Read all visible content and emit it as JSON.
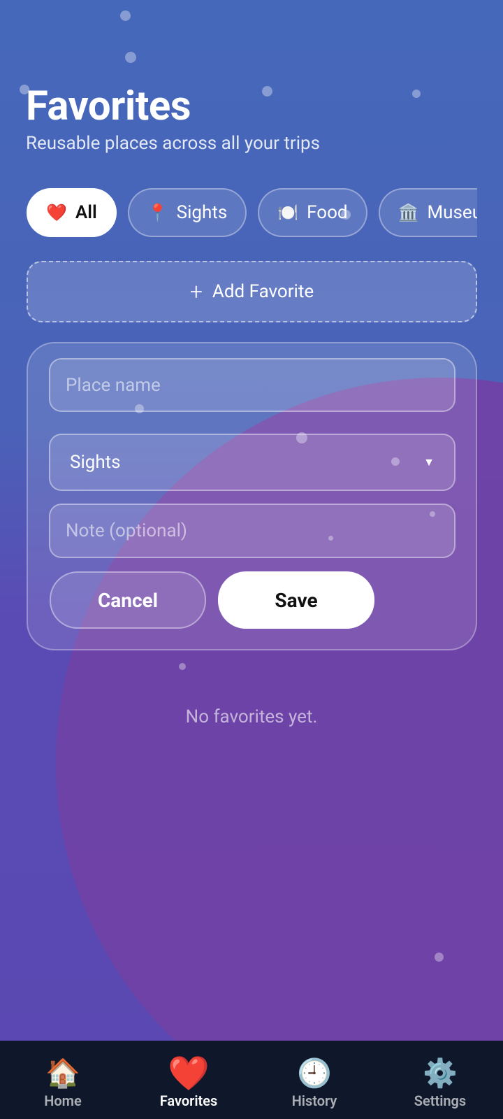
{
  "header": {
    "title": "Favorites",
    "subtitle": "Reusable places across all your trips"
  },
  "filters": [
    {
      "emoji": "❤️",
      "label": "All",
      "active": true
    },
    {
      "emoji": "📍",
      "label": "Sights",
      "active": false
    },
    {
      "emoji": "🍽️",
      "label": "Food",
      "active": false
    },
    {
      "emoji": "🏛️",
      "label": "Museums",
      "active": false
    }
  ],
  "add_button": {
    "icon": "+",
    "label": "Add Favorite"
  },
  "form": {
    "name_placeholder": "Place name",
    "category_value": "Sights",
    "category_caret": "▼",
    "note_placeholder": "Note (optional)",
    "cancel_label": "Cancel",
    "save_label": "Save"
  },
  "empty_state": "No favorites yet.",
  "nav": [
    {
      "icon": "🏠",
      "label": "Home",
      "active": false
    },
    {
      "icon": "❤️",
      "label": "Favorites",
      "active": true
    },
    {
      "icon": "🕘",
      "label": "History",
      "active": false
    },
    {
      "icon": "⚙️",
      "label": "Settings",
      "active": false
    }
  ],
  "colors": {
    "nav_background": "#0f172a",
    "accent_white": "#ffffff",
    "background_blue": "#4568ba",
    "background_purple": "#7042a6"
  }
}
